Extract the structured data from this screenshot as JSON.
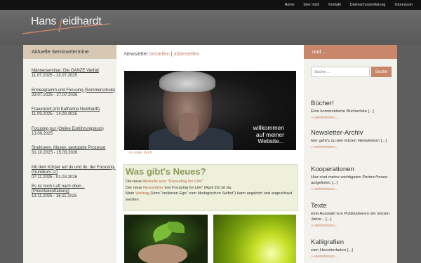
{
  "topnav": [
    "Home",
    "über mich",
    "Kontakt",
    "Datenschutzerklärung",
    "Impressum"
  ],
  "logo": {
    "first": "Hans",
    "last": "eidhardt"
  },
  "left": {
    "heading": "Aktuelle Seminartermine",
    "items": [
      {
        "title": "Männerseminar: Die GANZE Vielfalt",
        "date": "11.07.2025 - 13.07.2025"
      },
      {
        "title": "Enneagramm und Focusing (Sommerschule)",
        "date": "23.07.2025 - 27.07.2025"
      },
      {
        "title": "Frauenzeit (mit Katharina Neidhardt)",
        "date": "11.09.2025 - 14.09.2025"
      },
      {
        "title": "Focusing pur (Online Einführungskurs)",
        "date": "13.09.2025"
      },
      {
        "title": "Strukturen, Muster, gestoppte Prozesse",
        "date": "31.10.2025 - 15.03.2026"
      },
      {
        "title": "Mit dem Körper auf du und du: der Focusing-Grundkurs (1)",
        "date": "07.11.2025 - 01.03.2026"
      },
      {
        "title": "Es ist noch Luft nach oben... (Potentialentfaltung)",
        "date": "13.11.2025 - 16.11.2025"
      }
    ]
  },
  "main": {
    "newsletter_label": "Newsletter",
    "subscribe": "bestellen",
    "sep": "|",
    "unsubscribe": "abbestellen",
    "hero_text": [
      "willkommen",
      "auf meiner",
      "Website..."
    ],
    "more_about": ">> über mich",
    "news_title": "Was gibt's Neues?",
    "news_line1_pre": "Die neue",
    "news_line1_link": "Website von \"Focusing for Life\"",
    "news_line2_pre": "Der neue",
    "news_line2_link": "Newsletter",
    "news_line2_post": "von Focusing for Life\" (April 25) ist da.",
    "news_line3_pre": "Mein",
    "news_line3_link": "Vortrag",
    "news_line3_post": "(Vom \"isolierten Ego\" zum ökologischen Selbst\") kann angehört und angeschaut werden"
  },
  "right": {
    "heading": "und ...",
    "search_placeholder": "Suche ...",
    "search_button": "Suche",
    "blocks": [
      {
        "title": "Bücher!",
        "text": "Eine kommentierte Bücherliste [...]",
        "more": "» weiterlesen..."
      },
      {
        "title": "Newsletter-Archiv",
        "text": "hier geht's zu den letzten Newslettern [...]",
        "more": "» weiterlesen..."
      },
      {
        "title": "Kooperationen",
        "text": "Hier sind meine wichtigsten Partner*innen aufgelistet. [...]",
        "more": "» weiterlesen..."
      },
      {
        "title": "Texte",
        "text": "eine Auswahl von Publikationen der letzten Jahre... [...]",
        "more": "» weiterlesen..."
      },
      {
        "title": "Kalligrafien",
        "text": "zum Herunterladen [...]",
        "more": "» weiterlesen..."
      }
    ]
  },
  "colors": {
    "accent": "#c8876b",
    "news_title": "#8a9a5b",
    "left_head": "#d6c8b3"
  }
}
